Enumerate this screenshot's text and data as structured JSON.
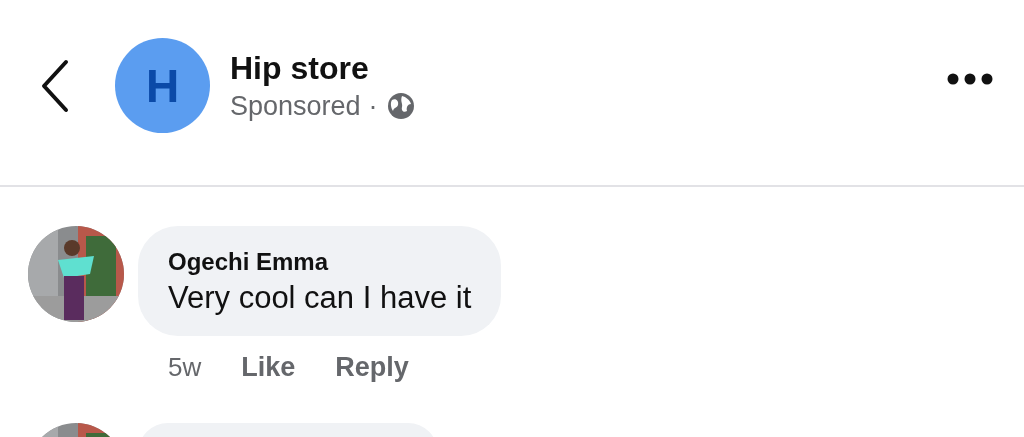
{
  "header": {
    "page_name": "Hip store",
    "avatar_letter": "H",
    "subtitle": "Sponsored",
    "separator": "·"
  },
  "comments": [
    {
      "author": "Ogechi Emma",
      "text": "Very cool can I have it",
      "time": "5w",
      "actions": [
        "Like",
        "Reply"
      ]
    }
  ]
}
